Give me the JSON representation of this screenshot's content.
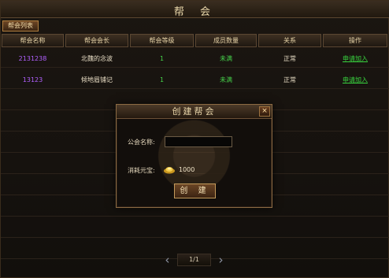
{
  "window": {
    "title": "帮 会",
    "close_label": "×"
  },
  "tabs": [
    {
      "label": "帮会列表"
    }
  ],
  "table": {
    "headers": [
      "帮会名称",
      "帮会会长",
      "帮会等级",
      "成员数量",
      "关系",
      "操作"
    ],
    "rows": [
      {
        "name": "2131238",
        "leader": "北魏的念波",
        "level": "1",
        "members": "未满",
        "relation": "正常",
        "action": "申请加入"
      },
      {
        "name": "13123",
        "leader": "倾地眉铺记",
        "level": "1",
        "members": "未满",
        "relation": "正常",
        "action": "申请加入"
      }
    ]
  },
  "dialog": {
    "title": "创建帮会",
    "close_label": "×",
    "name_label": "公会名称:",
    "name_value": "",
    "cost_label": "消耗元宝:",
    "cost_value": "1000",
    "create_label": "创 建"
  },
  "pager": {
    "prev_icon": "‹",
    "page": "1/1",
    "next_icon": "›"
  },
  "colors": {
    "accent": "#b07e3f",
    "id_purple": "#b160ff",
    "green": "#45d04a"
  }
}
